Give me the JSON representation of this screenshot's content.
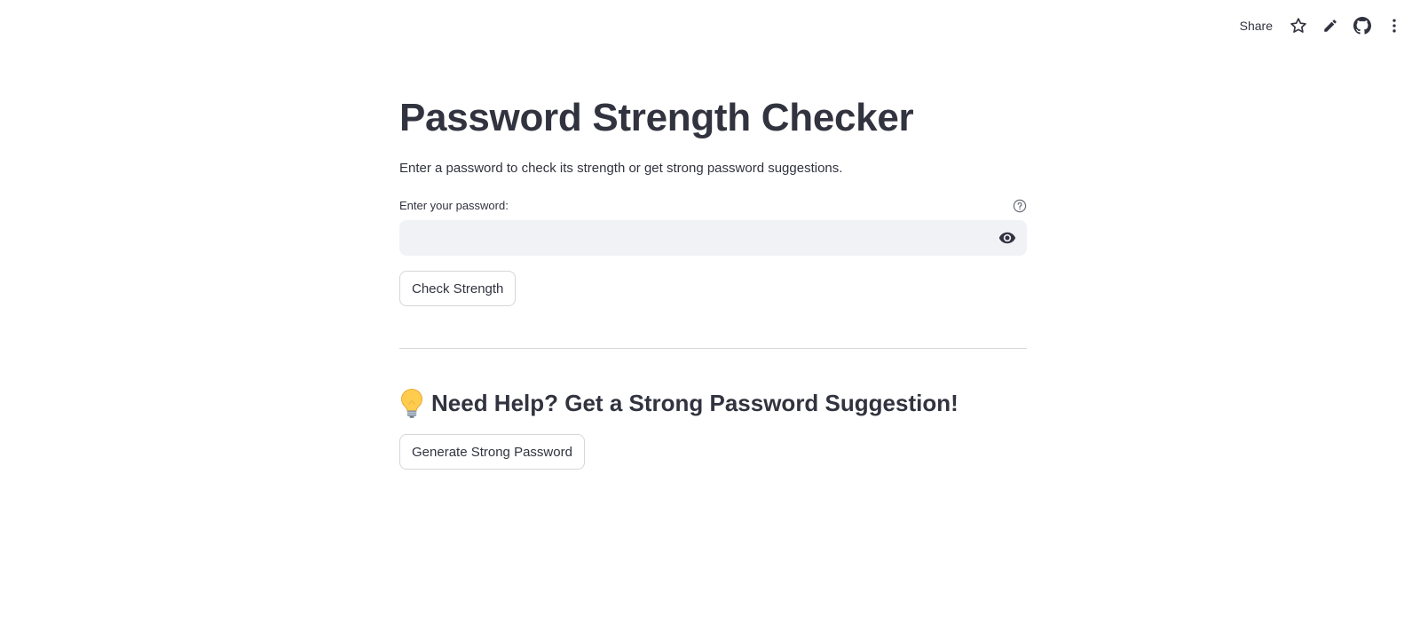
{
  "toolbar": {
    "share_label": "Share",
    "icons": [
      "star-icon",
      "pencil-icon",
      "github-icon",
      "more-vertical-icon"
    ]
  },
  "main": {
    "title": "Password Strength Checker",
    "subtitle": "Enter a password to check its strength or get strong password suggestions.",
    "password_field": {
      "label": "Enter your password:",
      "value": "",
      "placeholder": "",
      "help_icon": "help-circle-icon",
      "visibility_icon": "eye-icon"
    },
    "check_button_label": "Check Strength",
    "suggestion_section": {
      "icon": "lightbulb-icon",
      "heading": "Need Help? Get a Strong Password Suggestion!",
      "generate_button_label": "Generate Strong Password"
    }
  },
  "colors": {
    "text": "#31333f",
    "input_background": "#f0f2f6",
    "border": "#d5d6da",
    "background": "#ffffff"
  }
}
